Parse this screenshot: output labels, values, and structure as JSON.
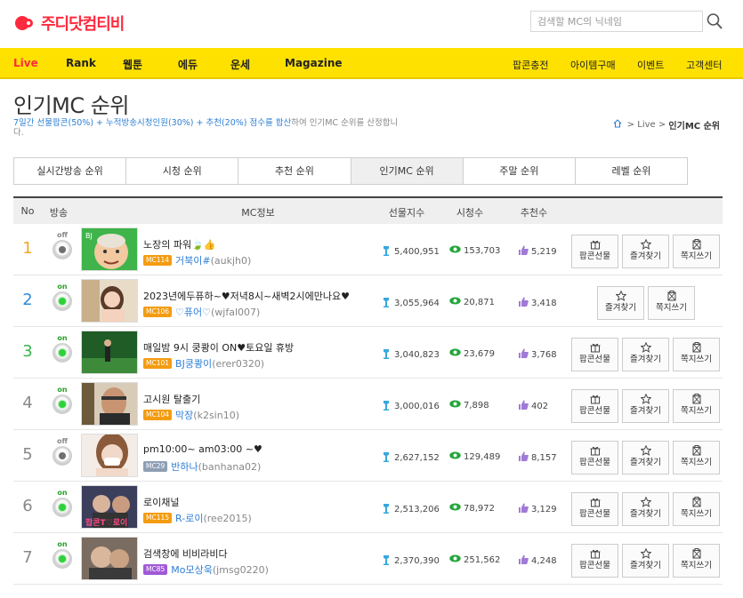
{
  "header": {
    "logo_text": "주디닷컴티비",
    "search_placeholder": "검색할 MC의 닉네임"
  },
  "nav": {
    "main": [
      "Live",
      "Rank",
      "웹툰",
      "에듀",
      "운세",
      "Magazine"
    ],
    "right": [
      "팝콘충전",
      "아이템구매",
      "이벤트",
      "고객센터"
    ]
  },
  "page": {
    "title": "인기MC 순위",
    "desc_highlight": "7일간 선물팝콘(50%) + 누적방송시청인원(30%) + 추천(20%) 점수를 합산",
    "desc_rest": "하여 인기MC 순위를 산정합니다.",
    "breadcrumb_mid": "Live",
    "breadcrumb_current": "인기MC 순위"
  },
  "tabs": [
    "실시간방송 순위",
    "시청 순위",
    "추천 순위",
    "인기MC 순위",
    "주말 순위",
    "레벨 순위"
  ],
  "active_tab": 3,
  "table": {
    "headers": [
      "No",
      "방송",
      "MC정보",
      "선물지수",
      "시청수",
      "추천수"
    ],
    "rows": [
      {
        "no": "1",
        "status": "off",
        "title": "노장의 파워",
        "title_extra": "🍃👍",
        "badge": "MC114",
        "name": "거북이#",
        "id": "(aukjh0)",
        "gift": "5,400,951",
        "views": "153,703",
        "recs": "5,219",
        "actions": [
          "팝콘선물",
          "즐겨찾기",
          "쪽지쓰기"
        ]
      },
      {
        "no": "2",
        "status": "on",
        "title": "2023년에두퓨하~♥저녁8시~새벽2시에만나요♥",
        "title_extra": "",
        "badge": "MC106",
        "name": "♡퓨어♡",
        "id": "(wjfal007)",
        "gift": "3,055,964",
        "views": "20,871",
        "recs": "3,418",
        "actions": [
          "즐겨찾기",
          "쪽지쓰기"
        ]
      },
      {
        "no": "3",
        "status": "on",
        "title": "매일밤 9시 쿵쾅이 ON♥토요일 휴방",
        "title_extra": "",
        "badge": "MC101",
        "name": "BJ쿵쾅이",
        "id": "(erer0320)",
        "gift": "3,040,823",
        "views": "23,679",
        "recs": "3,768",
        "actions": [
          "팝콘선물",
          "즐겨찾기",
          "쪽지쓰기"
        ]
      },
      {
        "no": "4",
        "status": "on",
        "title": "고시원 탈출기",
        "title_extra": "",
        "badge": "MC104",
        "name": "막장",
        "id": "(k2sin10)",
        "gift": "3,000,016",
        "views": "7,898",
        "recs": "402",
        "actions": [
          "팝콘선물",
          "즐겨찾기",
          "쪽지쓰기"
        ]
      },
      {
        "no": "5",
        "status": "off",
        "title": "pm10:00~ am03:00 ~♥",
        "title_extra": "",
        "badge": "MC29",
        "name": "반하나",
        "id": "(banhana02)",
        "gift": "2,627,152",
        "views": "129,489",
        "recs": "8,157",
        "actions": [
          "팝콘선물",
          "즐겨찾기",
          "쪽지쓰기"
        ]
      },
      {
        "no": "6",
        "status": "on",
        "title": "로이채널",
        "title_extra": "",
        "badge": "MC115",
        "name": "R-로이",
        "id": "(ree2015)",
        "gift": "2,513,206",
        "views": "78,972",
        "recs": "3,129",
        "actions": [
          "팝콘선물",
          "즐겨찾기",
          "쪽지쓰기"
        ]
      },
      {
        "no": "7",
        "status": "on",
        "title": "검색창에 비비라비다",
        "title_extra": "",
        "badge": "MC85",
        "name": "Mo모상욱",
        "id": "(jmsg0220)",
        "gift": "2,370,390",
        "views": "251,562",
        "recs": "4,248",
        "actions": [
          "팝콘선물",
          "즐겨찾기",
          "쪽지쓰기"
        ]
      }
    ]
  },
  "thumb_text": {
    "row1": "BJ",
    "row6": "팝콘T♡로이"
  },
  "colors": {
    "brand": "#ff2a3d",
    "nav_bg": "#ffe100",
    "link_blue": "#2e7fd6",
    "on_green": "#2ca02c"
  }
}
